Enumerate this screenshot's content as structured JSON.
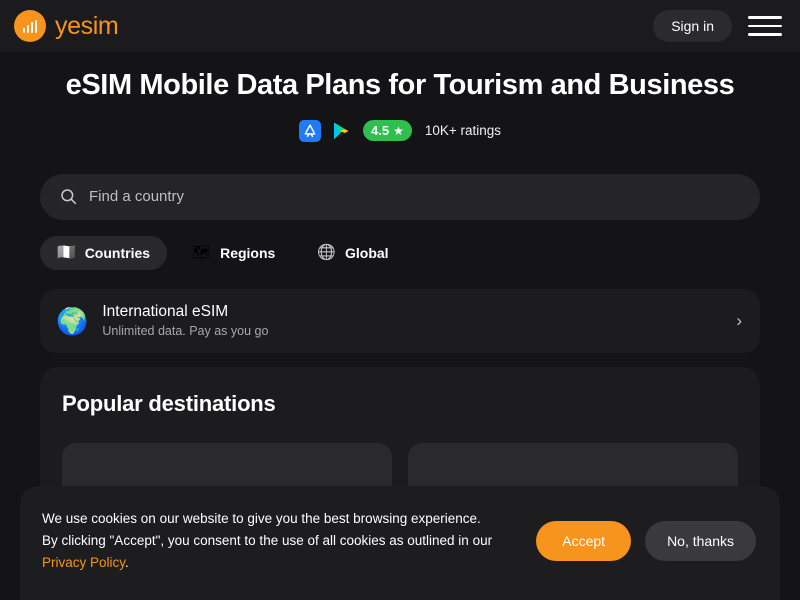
{
  "colors": {
    "page_bg": "#141416",
    "header_bg": "#1b1b1d",
    "brand_orange": "#F7941D",
    "rating_green": "#2FBF4E",
    "card_bg": "#1c1c1e",
    "input_bg": "#252527",
    "link_orange": "#F7941D"
  },
  "header": {
    "brand_name": "yesim",
    "brand_icon": "bar-chart-logo-icon",
    "signin_label": "Sign in",
    "menu_icon": "hamburger-menu-icon"
  },
  "hero": {
    "title": "eSIM Mobile Data Plans for Tourism and Business",
    "ratings": {
      "app_store_icon": "app-store-icon",
      "google_play_icon": "google-play-icon",
      "score": "4.5",
      "star_icon": "star-icon",
      "count_text": "10K+ ratings"
    }
  },
  "search": {
    "icon": "search-icon",
    "placeholder": "Find a country",
    "value": ""
  },
  "tabs": [
    {
      "label": "Countries",
      "icon": "italy-map-icon",
      "glyph": "🇮🇹",
      "active": true
    },
    {
      "label": "Regions",
      "icon": "europe-map-icon",
      "glyph": "🗺",
      "active": false
    },
    {
      "label": "Global",
      "icon": "world-map-icon",
      "glyph": "🌐",
      "active": false
    }
  ],
  "international_card": {
    "icon": "globe-icon",
    "glyph": "🌍",
    "title": "International eSIM",
    "subtitle": "Unlimited data. Pay as you go",
    "chevron": "chevron-right-icon",
    "chevron_glyph": "›"
  },
  "popular": {
    "title": "Popular destinations",
    "cards": [
      {
        "label": ""
      },
      {
        "label": ""
      }
    ]
  },
  "cookie_banner": {
    "line1": "We use cookies on our website to give you the best browsing experience.",
    "line2": "By clicking \"Accept\", you consent to the use of all cookies as outlined in our",
    "link_text": "Privacy Policy",
    "line3_suffix": ".",
    "accept_label": "Accept",
    "decline_label": "No, thanks"
  }
}
